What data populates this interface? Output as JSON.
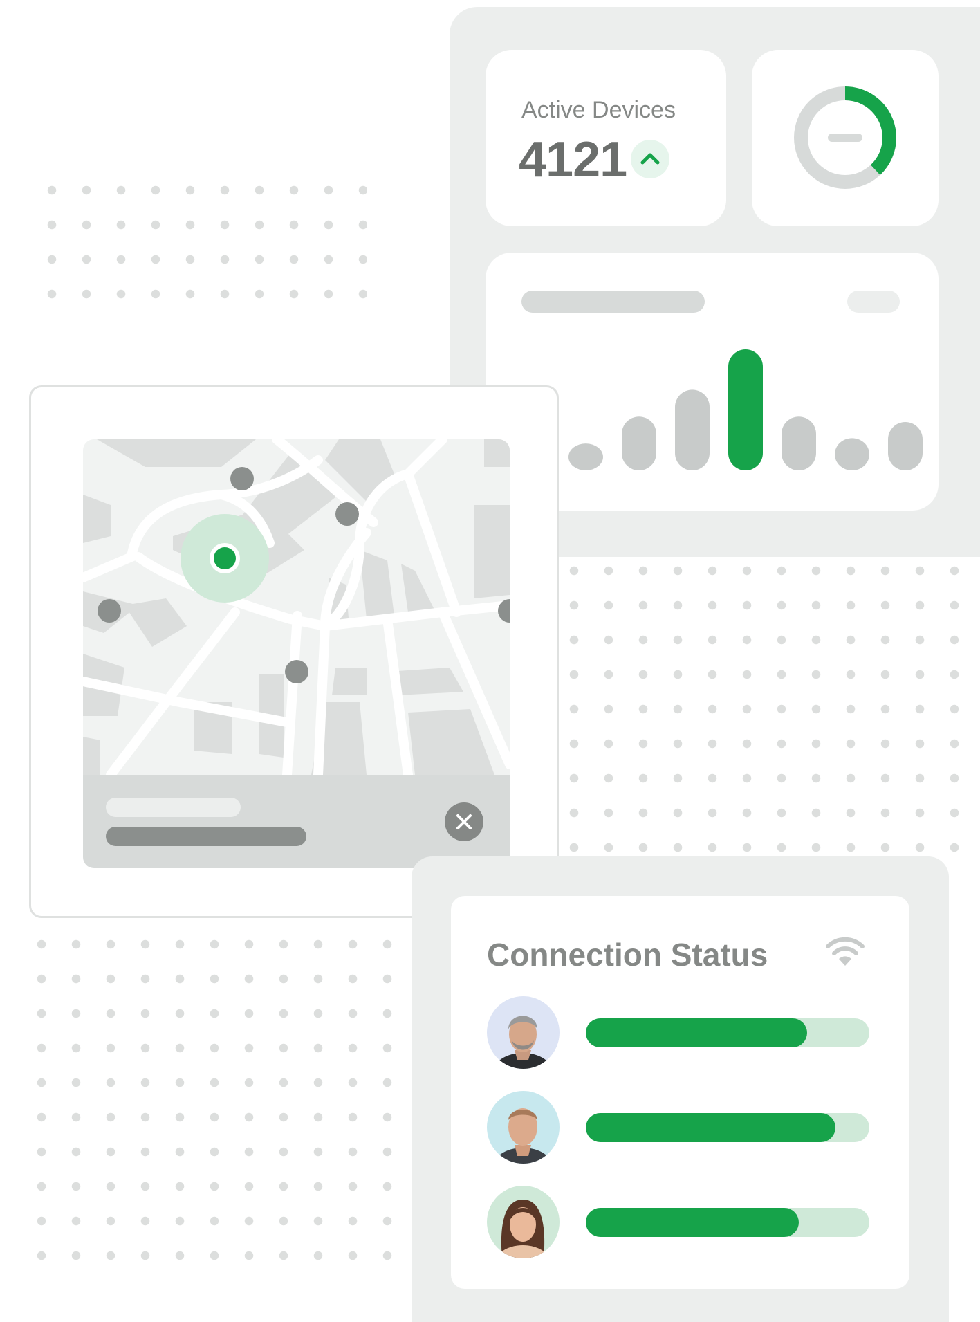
{
  "active_devices": {
    "label": "Active Devices",
    "value": "4121",
    "trend_icon": "chevron-up-icon"
  },
  "donut": {
    "progress": 0.38
  },
  "bar_chart": {
    "chart_data": {
      "type": "bar",
      "values": [
        1,
        2,
        3,
        4.5,
        2,
        1.2,
        1.8
      ],
      "highlight_index": 3,
      "highlight_color": "#16a34a",
      "bar_color": "#c8cbca"
    }
  },
  "map": {
    "active_marker_icon": "location-pin-icon",
    "close_icon": "close-icon"
  },
  "connection_status": {
    "title": "Connection Status",
    "status_icon": "wifi-icon",
    "users": [
      {
        "progress": 0.78
      },
      {
        "progress": 0.88
      },
      {
        "progress": 0.75
      }
    ]
  },
  "colors": {
    "accent": "#16a34a",
    "accent_light": "#cfe9d8",
    "text_muted": "#858886",
    "text_dark": "#6b6e6c"
  }
}
